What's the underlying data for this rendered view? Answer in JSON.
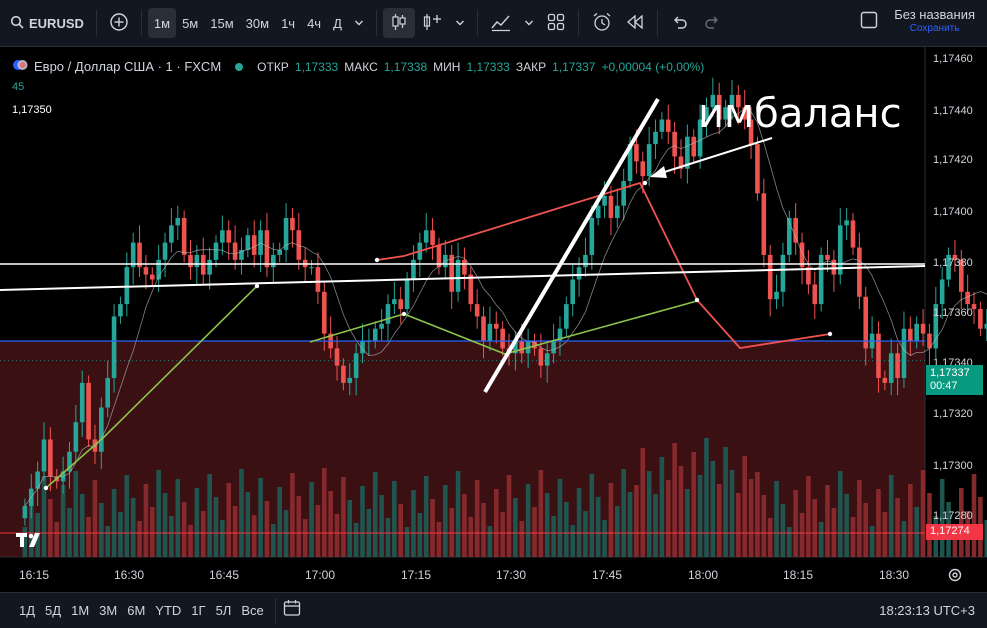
{
  "toolbar": {
    "symbol": "EURUSD",
    "intervals": [
      "1м",
      "5м",
      "15м",
      "30м",
      "1ч",
      "4ч",
      "Д"
    ],
    "active_interval": "1м",
    "save_title": "Без названия",
    "save_subtitle": "Сохранить"
  },
  "legend": {
    "name": "Евро / Доллар США · 1 · FXCM",
    "open_label": "ОТКР",
    "open": "1,17333",
    "high_label": "МАКС",
    "high": "1,17338",
    "low_label": "МИН",
    "low": "1,17333",
    "close_label": "ЗАКР",
    "close": "1,17337",
    "change": "+0,00004 (+0,00%)",
    "sub1": "45",
    "sub2": "1,17350"
  },
  "annotation": "имбаланс",
  "price_axis": [
    "1,17460",
    "1,17440",
    "1,17420",
    "1,17400",
    "1,17380",
    "1,17360",
    "1,17340",
    "1,17320",
    "1,17300",
    "1,17280"
  ],
  "current_price": {
    "price": "1,17337",
    "countdown": "00:47"
  },
  "low_marker": "1,17274",
  "time_axis": [
    "16:15",
    "16:30",
    "16:45",
    "17:00",
    "17:15",
    "17:30",
    "17:45",
    "18:00",
    "18:15",
    "18:30"
  ],
  "ranges": [
    "1Д",
    "5Д",
    "1М",
    "3М",
    "6М",
    "YTD",
    "1Г",
    "5Л",
    "Все"
  ],
  "clock": "18:23:13 UTC+3",
  "colors": {
    "up": "#26a69a",
    "down": "#ef5350",
    "blue_line": "#2962ff",
    "zone": "#3a1013"
  },
  "chart_data": {
    "type": "candlestick",
    "ylim": [
      1.1727,
      1.1747
    ],
    "x": [
      "16:12",
      "16:13",
      "16:14",
      "16:15",
      "16:16",
      "16:17",
      "16:18",
      "16:19",
      "16:20",
      "16:21",
      "16:22",
      "16:23",
      "16:24",
      "16:25",
      "16:26",
      "16:27",
      "16:28",
      "16:29",
      "16:30",
      "16:31",
      "16:32",
      "16:33",
      "16:34",
      "16:35",
      "16:36",
      "16:37",
      "16:38",
      "16:39",
      "16:40",
      "16:41",
      "16:42",
      "16:43",
      "16:44",
      "16:45",
      "16:46",
      "16:47",
      "16:48",
      "16:49",
      "16:50",
      "16:51",
      "16:52",
      "16:53",
      "16:54",
      "16:55",
      "16:56",
      "16:57",
      "16:58",
      "16:59",
      "17:00",
      "17:01",
      "17:02",
      "17:03",
      "17:04",
      "17:05",
      "17:06",
      "17:07",
      "17:08",
      "17:09",
      "17:10",
      "17:11",
      "17:12",
      "17:13",
      "17:14",
      "17:15",
      "17:16",
      "17:17",
      "17:18",
      "17:19",
      "17:20",
      "17:21",
      "17:22",
      "17:23",
      "17:24",
      "17:25",
      "17:26",
      "17:27",
      "17:28",
      "17:29",
      "17:30",
      "17:31",
      "17:32",
      "17:33",
      "17:34",
      "17:35",
      "17:36",
      "17:37",
      "17:38",
      "17:39",
      "17:40",
      "17:41",
      "17:42",
      "17:43",
      "17:44",
      "17:45",
      "17:46",
      "17:47",
      "17:48",
      "17:49",
      "17:50",
      "17:51",
      "17:52",
      "17:53",
      "17:54",
      "17:55",
      "17:56",
      "17:57",
      "17:58",
      "17:59",
      "18:00",
      "18:01",
      "18:02",
      "18:03",
      "18:04",
      "18:05",
      "18:06",
      "18:07",
      "18:08",
      "18:09",
      "18:10",
      "18:11",
      "18:12",
      "18:13",
      "18:14",
      "18:15",
      "18:16",
      "18:17",
      "18:18",
      "18:19",
      "18:20",
      "18:21",
      "18:22",
      "18:23"
    ],
    "close": [
      1.17278,
      1.17285,
      1.17292,
      1.17305,
      1.1729,
      1.17288,
      1.17292,
      1.173,
      1.17312,
      1.17328,
      1.17305,
      1.173,
      1.17318,
      1.1733,
      1.17355,
      1.1736,
      1.17375,
      1.17385,
      1.17375,
      1.17372,
      1.1737,
      1.17378,
      1.17385,
      1.17392,
      1.17395,
      1.1738,
      1.17375,
      1.1738,
      1.17372,
      1.17378,
      1.17385,
      1.1739,
      1.17385,
      1.17378,
      1.17382,
      1.17388,
      1.1738,
      1.1739,
      1.17375,
      1.1738,
      1.17382,
      1.17395,
      1.1739,
      1.17378,
      1.17375,
      1.17375,
      1.17365,
      1.17348,
      1.17342,
      1.17335,
      1.17328,
      1.1733,
      1.1734,
      1.17345,
      1.17345,
      1.1735,
      1.17352,
      1.1736,
      1.17362,
      1.17358,
      1.1737,
      1.17378,
      1.17385,
      1.1739,
      1.17384,
      1.17375,
      1.1738,
      1.17365,
      1.17378,
      1.17372,
      1.1736,
      1.17355,
      1.17345,
      1.17352,
      1.1735,
      1.17342,
      1.1734,
      1.17345,
      1.1734,
      1.17345,
      1.17342,
      1.17335,
      1.1734,
      1.17345,
      1.1735,
      1.1736,
      1.1737,
      1.17375,
      1.1738,
      1.17395,
      1.174,
      1.17404,
      1.17395,
      1.174,
      1.1741,
      1.17425,
      1.17418,
      1.17412,
      1.17425,
      1.1743,
      1.17435,
      1.1743,
      1.1742,
      1.17415,
      1.17428,
      1.1742,
      1.17435,
      1.1744,
      1.17445,
      1.17435,
      1.1744,
      1.17445,
      1.1744,
      1.17435,
      1.17425,
      1.17405,
      1.1738,
      1.17362,
      1.17365,
      1.1738,
      1.17395,
      1.17385,
      1.17375,
      1.17368,
      1.1736,
      1.1738,
      1.17378,
      1.17372,
      1.17392,
      1.17394,
      1.17383,
      1.17363,
      1.17342,
      1.17348,
      1.1733,
      1.17328,
      1.1734,
      1.1733,
      1.1735,
      1.17345,
      1.17352,
      1.17348,
      1.17342,
      1.1736,
      1.1737,
      1.1738,
      1.17378,
      1.17365,
      1.1736,
      1.17358,
      1.1735,
      1.17352,
      1.17342,
      1.17338,
      1.17333,
      1.17337
    ],
    "trendlines": [
      "green lines",
      "red lines",
      "white horizontal line",
      "white diagonal line",
      "blue price line"
    ]
  }
}
